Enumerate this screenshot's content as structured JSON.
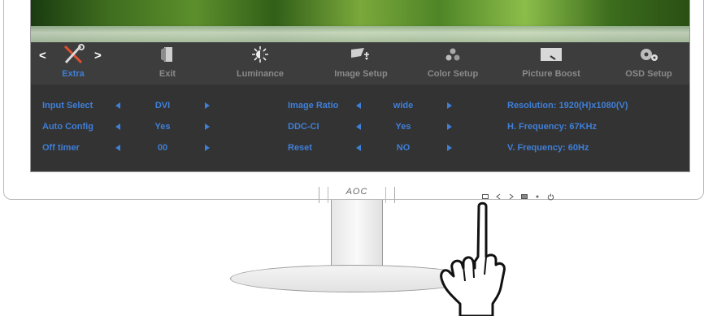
{
  "menu": {
    "items": [
      {
        "label": "Extra",
        "icon": "tools-icon"
      },
      {
        "label": "Exit",
        "icon": "exit-door-icon"
      },
      {
        "label": "Luminance",
        "icon": "brightness-icon"
      },
      {
        "label": "Image Setup",
        "icon": "image-setup-icon"
      },
      {
        "label": "Color Setup",
        "icon": "color-setup-icon"
      },
      {
        "label": "Picture Boost",
        "icon": "picture-boost-icon"
      },
      {
        "label": "OSD Setup",
        "icon": "osd-setup-icon"
      }
    ],
    "active_index": 0,
    "prev_arrow": "<",
    "next_arrow": ">"
  },
  "settings": {
    "col1": [
      {
        "label": "Input Select",
        "value": "DVI"
      },
      {
        "label": "Auto Config",
        "value": "Yes"
      },
      {
        "label": "Off timer",
        "value": "00"
      }
    ],
    "col2": [
      {
        "label": "Image Ratio",
        "value": "wide"
      },
      {
        "label": "DDC-CI",
        "value": "Yes"
      },
      {
        "label": "Reset",
        "value": "NO"
      }
    ],
    "info": {
      "resolution": "Resolution:  1920(H)x1080(V)",
      "h_frequency": "H. Frequency:  67KHz",
      "v_frequency": "V. Frequency:  60Hz"
    }
  },
  "bezel": {
    "logo": "AOC",
    "buttons": [
      "menu-button",
      "left-button",
      "right-button",
      "auto-button",
      "dot",
      "power-button"
    ]
  },
  "colors": {
    "accent": "#3f7fd8",
    "menu_bg": "#3d3d3d",
    "panel_bg": "#333333",
    "inactive_label": "#8a8a8a"
  }
}
